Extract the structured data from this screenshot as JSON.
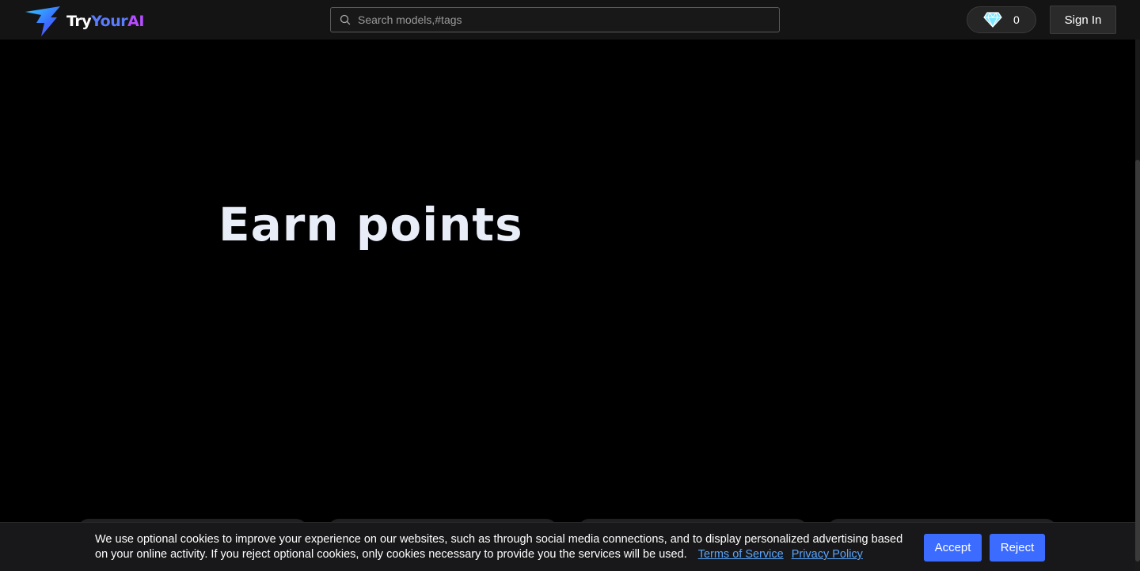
{
  "header": {
    "logo": {
      "try": "Try",
      "your": "Your",
      "ai": "AI"
    },
    "search": {
      "placeholder": "Search models,#tags",
      "value": ""
    },
    "points": {
      "icon": "diamond-icon",
      "value": "0"
    },
    "signin_label": "Sign In"
  },
  "hero": {
    "title": "Earn points"
  },
  "cookie_banner": {
    "text": "We use optional cookies to improve your experience on our websites, such as through social media connections, and to display personalized advertising based on your online activity. If you reject optional cookies, only cookies necessary to provide you the services will be used.",
    "terms_label": "Terms of Service",
    "privacy_label": "Privacy Policy",
    "accept_label": "Accept",
    "reject_label": "Reject"
  },
  "colors": {
    "background": "#000000",
    "header_bg": "#141414",
    "accent": "#3c6cff",
    "logo_your": "#5b7cff",
    "logo_ai": "#b44dff",
    "hero_text": "#e9edf7",
    "link": "#58a6ff"
  }
}
